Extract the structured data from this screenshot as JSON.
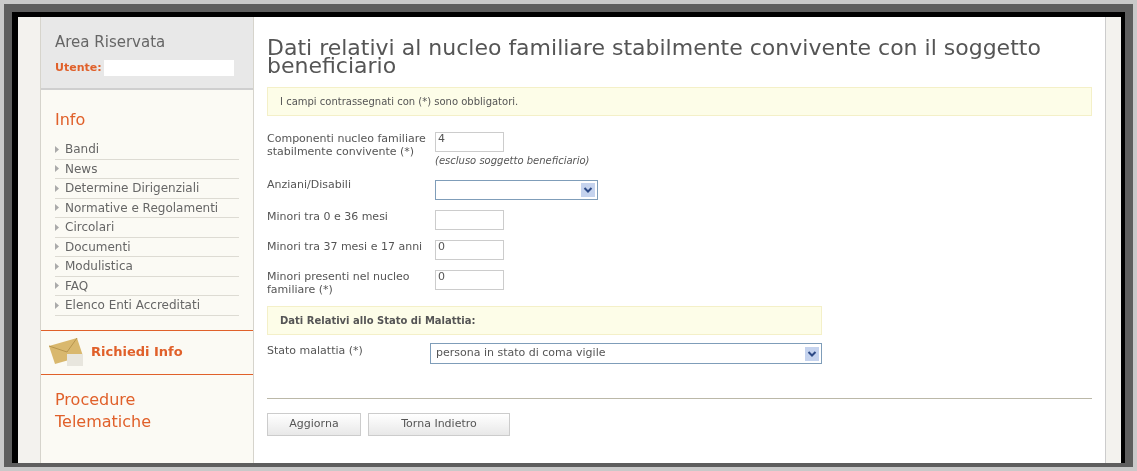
{
  "sidebar": {
    "area_title": "Area Riservata",
    "user_label": "Utente:",
    "info_title": "Info",
    "menu": [
      {
        "label": "Bandi"
      },
      {
        "label": "News"
      },
      {
        "label": "Determine Dirigenziali"
      },
      {
        "label": "Normative e Regolamenti"
      },
      {
        "label": "Circolari"
      },
      {
        "label": "Documenti"
      },
      {
        "label": "Modulistica"
      },
      {
        "label": "FAQ"
      },
      {
        "label": "Elenco Enti Accreditati"
      }
    ],
    "request_info": "Richiedi Info",
    "procedures_title": "Procedure Telematiche"
  },
  "main": {
    "title": "Dati relativi al nucleo familiare stabilmente convivente con il soggetto beneficiario",
    "required_note": "I campi contrassegnati con (*) sono obbligatori.",
    "fields": [
      {
        "kind": "text",
        "label": "Componenti nucleo familiare stabilmente convivente (*)",
        "value": "4",
        "hint": "(escluso soggetto beneficiario)"
      },
      {
        "kind": "select",
        "label": "Anziani/Disabili"
      },
      {
        "kind": "text",
        "label": "Minori tra 0 e 36 mesi"
      },
      {
        "kind": "text",
        "label": "Minori tra 37 mesi e 17 anni",
        "value": "0"
      },
      {
        "kind": "text",
        "label": "Minori presenti nel nucleo familiare (*)",
        "value": "0"
      }
    ],
    "illness_section": "Dati Relativi allo Stato di Malattia:",
    "illness_field": {
      "label": "Stato malattia (*)",
      "value": "persona in stato di coma vigile"
    },
    "buttons": [
      "Aggiorna",
      "Torna Indietro"
    ]
  }
}
